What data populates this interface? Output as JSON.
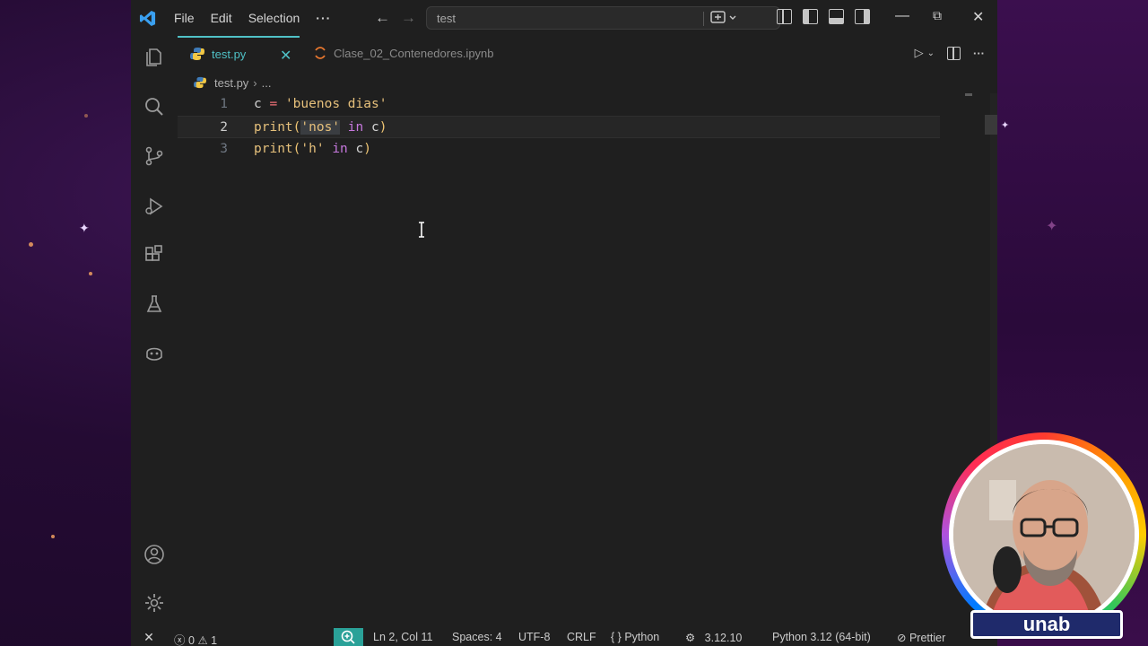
{
  "titlebar": {
    "menu": [
      "File",
      "Edit",
      "Selection",
      "···"
    ],
    "search_text": "test"
  },
  "tabs": [
    {
      "label": "test.py",
      "active": true,
      "icon": "python-icon"
    },
    {
      "label": "Clase_02_Contenedores.ipynb",
      "active": false,
      "icon": "jupyter-icon"
    }
  ],
  "breadcrumb": {
    "file": "test.py",
    "rest": "..."
  },
  "editor": {
    "lines": [
      {
        "number": "1",
        "code": "c = 'buenos dias'"
      },
      {
        "number": "2",
        "code": "print('nos' in c)"
      },
      {
        "number": "3",
        "code": "print('h' in c)"
      }
    ],
    "current_line": 2
  },
  "statusbar": {
    "errors": "0",
    "warnings": "1",
    "position": "Ln 2, Col 11",
    "spaces": "Spaces: 4",
    "encoding": "UTF-8",
    "eol": "CRLF",
    "language": "Python",
    "version": "3.12.10",
    "interpreter": "Python 3.12 (64-bit)",
    "formatter": "Prettier"
  },
  "overlay": {
    "logo_text": "unab"
  },
  "colors": {
    "accent": "#4fc1c6",
    "string": "#e6c07b",
    "keyword": "#c678dd",
    "operator": "#f07178"
  }
}
